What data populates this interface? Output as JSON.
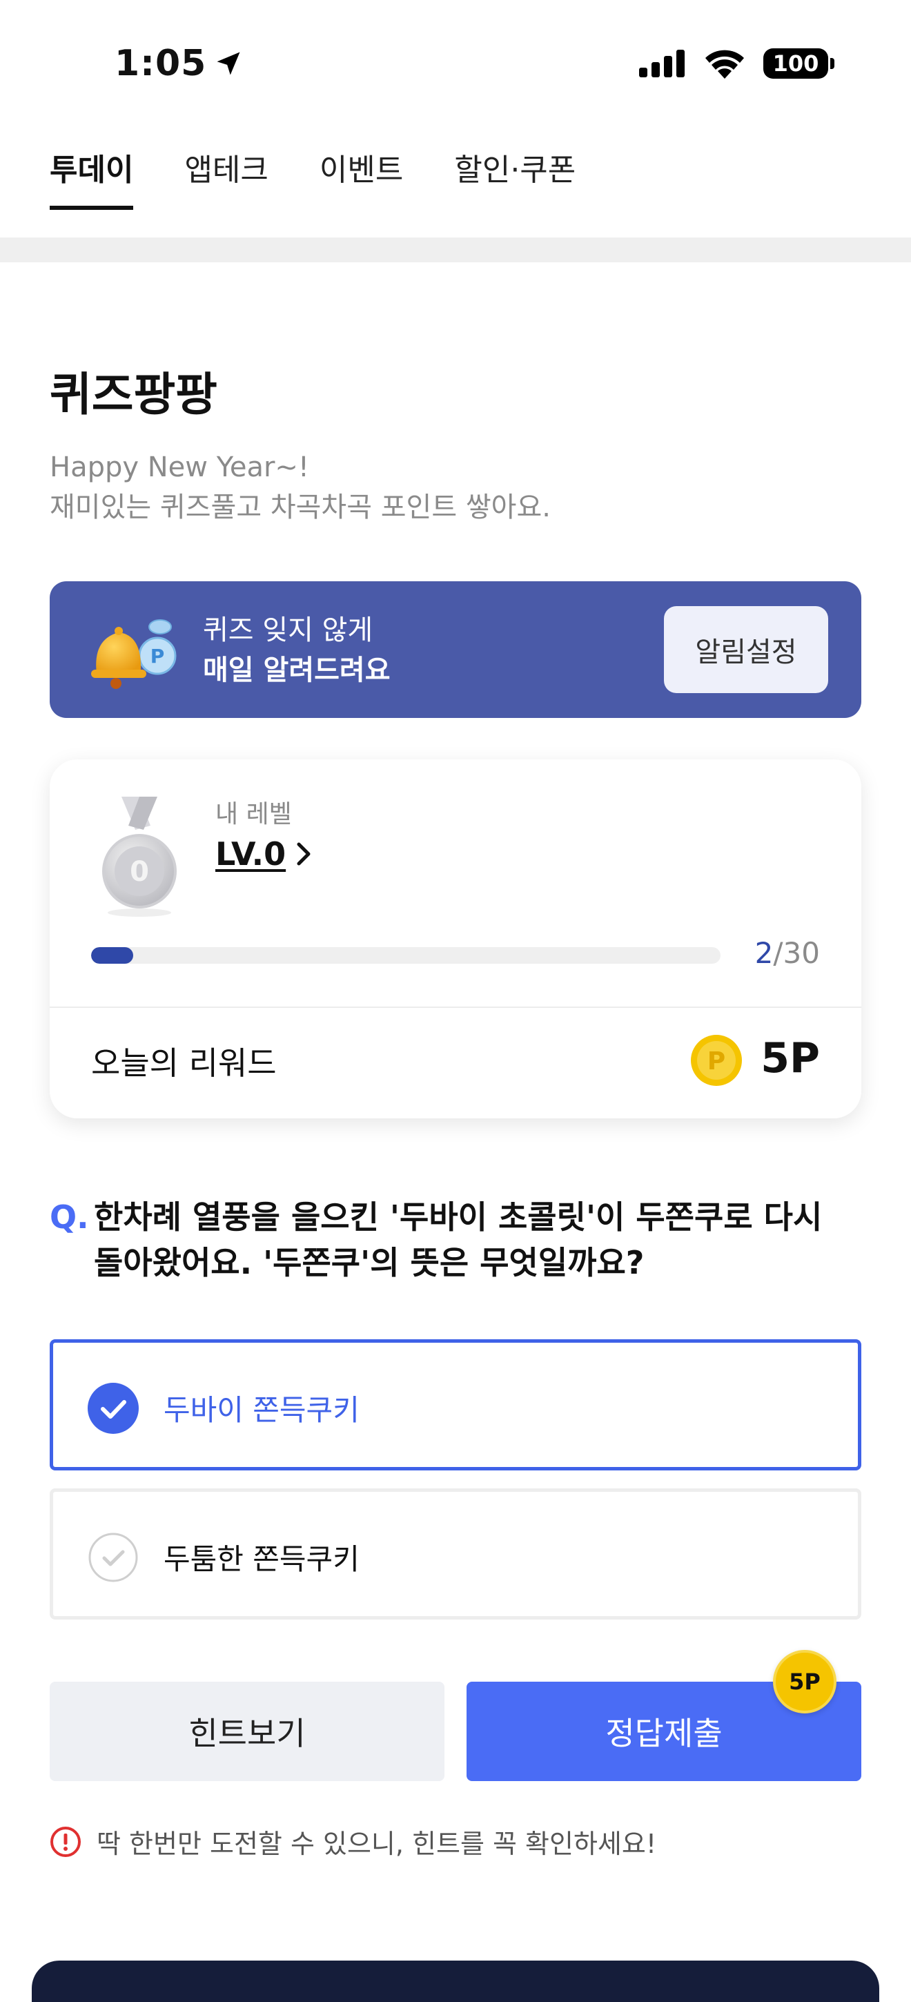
{
  "status_bar": {
    "time": "1:05",
    "battery": "100"
  },
  "tabs": [
    {
      "label": "투데이",
      "active": true
    },
    {
      "label": "앱테크",
      "active": false
    },
    {
      "label": "이벤트",
      "active": false
    },
    {
      "label": "할인·쿠폰",
      "active": false
    }
  ],
  "page": {
    "title": "퀴즈팡팡",
    "subtitle_line1": "Happy New Year~!",
    "subtitle_line2": "재미있는 퀴즈풀고 차곡차곡 포인트 쌓아요."
  },
  "banner": {
    "line1": "퀴즈 잊지 않게",
    "line2": "매일 알려드려요",
    "button_label": "알림설정"
  },
  "level_card": {
    "level_label": "내 레벨",
    "level_value": "LV.0",
    "medal_number": "0",
    "progress_current": "2",
    "progress_total": "/30",
    "progress_fraction": 0.0667,
    "reward_label": "오늘의 리워드",
    "reward_coin_symbol": "P",
    "reward_value": "5P"
  },
  "question": {
    "prefix": "Q.",
    "text": "한차례 열풍을 을으킨 '두바이 초콜릿'이 두쫀쿠로 다시 돌아왔어요. '두쫀쿠'의 뜻은 무엇일까요?"
  },
  "options": [
    {
      "label": "두바이 쫀득쿠키",
      "selected": true
    },
    {
      "label": "두툼한 쫀득쿠키",
      "selected": false
    }
  ],
  "actions": {
    "hint_label": "힌트보기",
    "submit_label": "정답제출",
    "submit_badge": "5P"
  },
  "warning": {
    "text": "딱 한번만 도전할 수 있으니, 힌트를 꼭 확인하세요!"
  },
  "colors": {
    "accent": "#4a6cf5",
    "banner": "#4a5aa8",
    "progress": "#2f48a8",
    "coin": "#f5c400",
    "warning": "#e03030"
  }
}
